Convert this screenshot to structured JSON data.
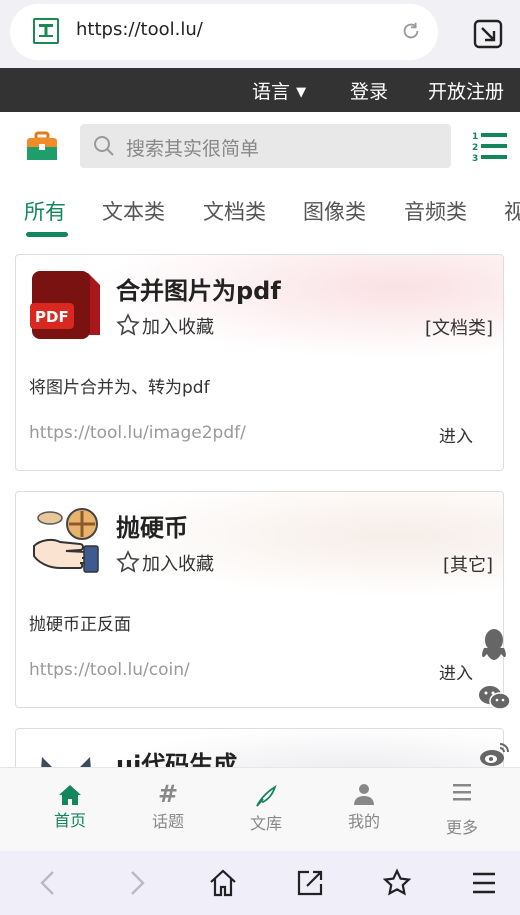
{
  "browser": {
    "url": "https://tool.lu/"
  },
  "topnav": {
    "language": "语言",
    "login": "登录",
    "register": "开放注册"
  },
  "search": {
    "placeholder": "搜索其实很简单"
  },
  "tabs": [
    {
      "label": "所有",
      "active": true
    },
    {
      "label": "文本类"
    },
    {
      "label": "文档类"
    },
    {
      "label": "图像类"
    },
    {
      "label": "音频类"
    },
    {
      "label": "视"
    }
  ],
  "cards": [
    {
      "title": "合并图片为pdf",
      "favorite": "加入收藏",
      "category": "[文档类]",
      "description": "将图片合并为、转为pdf",
      "url": "https://tool.lu/image2pdf/",
      "enter": "进入",
      "icon": "pdf-file-icon"
    },
    {
      "title": "抛硬币",
      "favorite": "加入收藏",
      "category": "[其它]",
      "description": "抛硬币正反面",
      "url": "https://tool.lu/coin/",
      "enter": "进入",
      "icon": "coin-toss-icon"
    },
    {
      "title": "ui代码生成",
      "icon": "cat-icon"
    }
  ],
  "appnav": [
    {
      "label": "首页",
      "icon": "home-icon",
      "active": true
    },
    {
      "label": "话题",
      "icon": "hash-icon"
    },
    {
      "label": "文库",
      "icon": "quill-icon"
    },
    {
      "label": "我的",
      "icon": "user-icon"
    },
    {
      "label": "更多",
      "icon": "menu-icon"
    }
  ],
  "colors": {
    "accent": "#13865c",
    "topnav_bg": "#333333"
  }
}
